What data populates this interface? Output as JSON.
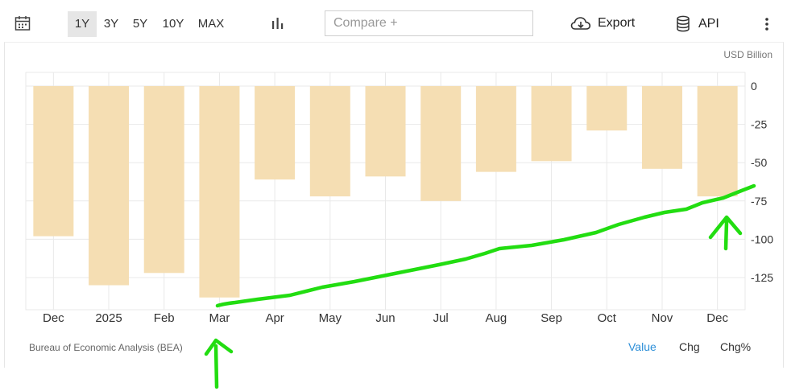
{
  "toolbar": {
    "periods": [
      "1Y",
      "3Y",
      "5Y",
      "10Y",
      "MAX"
    ],
    "active_period": "1Y",
    "compare_placeholder": "Compare +",
    "export_label": "Export",
    "api_label": "API"
  },
  "footer": {
    "source": "Bureau of Economic Analysis (BEA)",
    "modes": [
      "Value",
      "Chg",
      "Chg%"
    ],
    "active_mode": "Value"
  },
  "colors": {
    "bar": "#f5deb3",
    "grid": "#e9e9e9",
    "annotation": "#22dd11",
    "active_mode": "#2d8fd8"
  },
  "chart_data": {
    "type": "bar",
    "unit_label": "USD Billion",
    "categories": [
      "Dec",
      "2025",
      "Feb",
      "Mar",
      "Apr",
      "May",
      "Jun",
      "Jul",
      "Aug",
      "Sep",
      "Oct",
      "Nov",
      "Dec"
    ],
    "values": [
      -98,
      -130,
      -122,
      -138,
      -61,
      -72,
      -59,
      -75,
      -56,
      -49,
      -29,
      -54,
      -72
    ],
    "ylim": [
      -146,
      0
    ],
    "yticks": [
      0,
      -25,
      -50,
      -75,
      -100,
      -125
    ],
    "y_axis_side": "right",
    "grid": true,
    "annotations": [
      "hand-drawn green upward trend line",
      "green arrow under Mar",
      "green arrow under Dec"
    ]
  }
}
